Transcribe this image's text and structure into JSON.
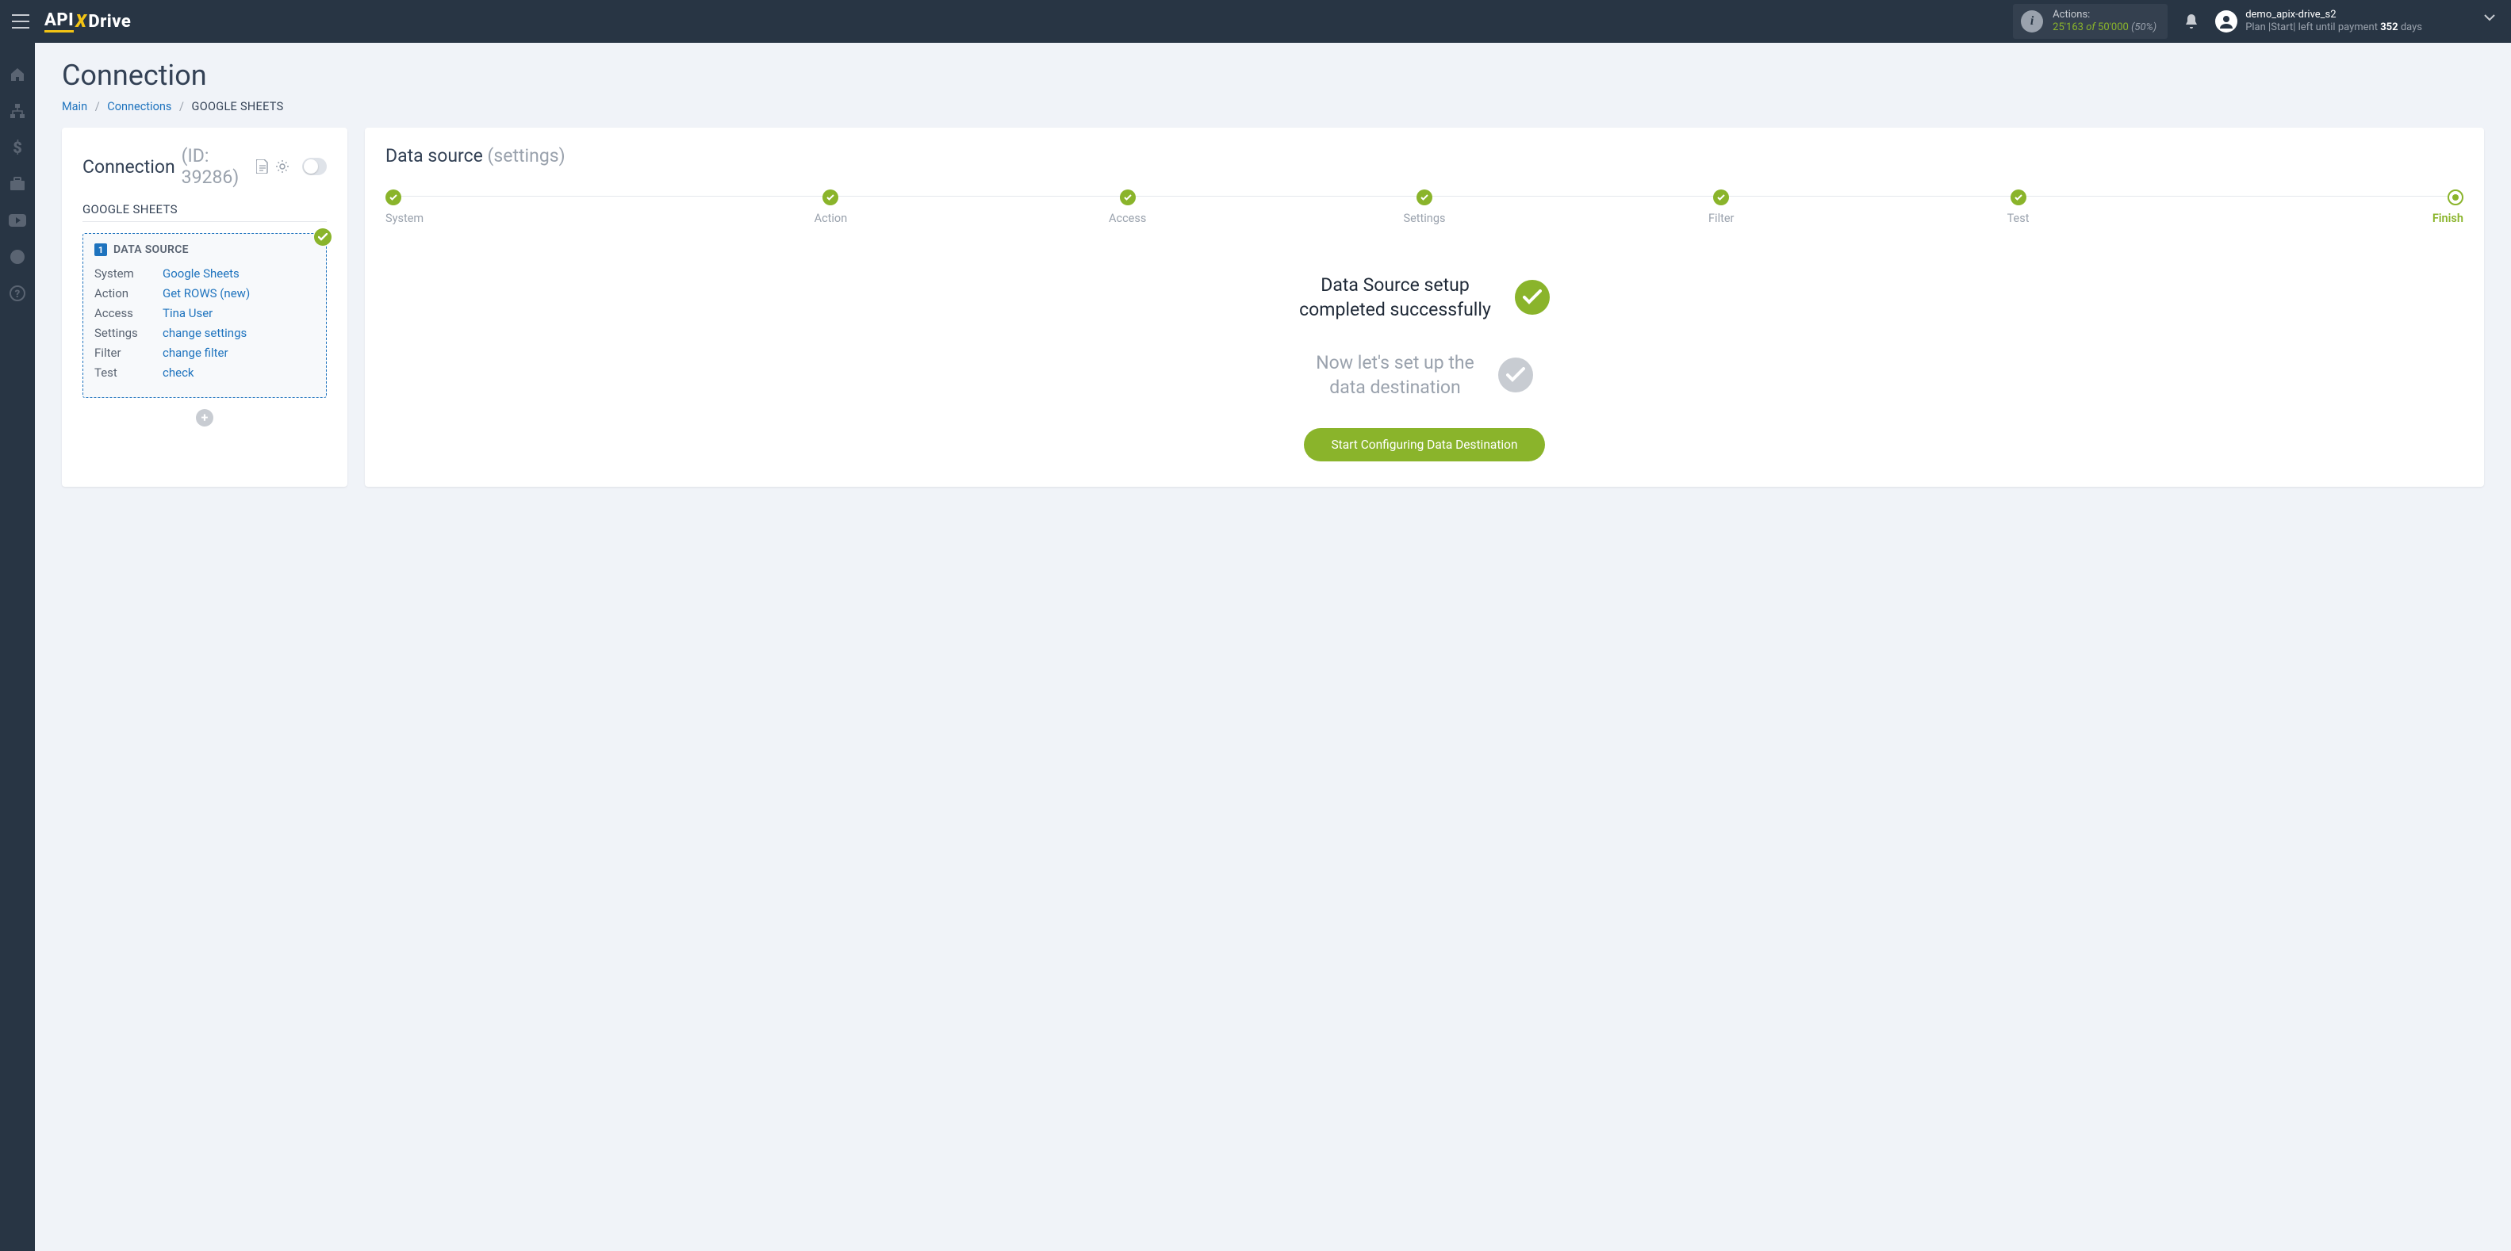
{
  "header": {
    "logo_left": "API",
    "logo_right": "Drive",
    "actions": {
      "label": "Actions:",
      "used": "25'163",
      "of": "of",
      "total": "50'000",
      "pct": "(50%)"
    },
    "user": {
      "name": "demo_apix-drive_s2",
      "plan_prefix": "Plan |Start| left until payment",
      "days_num": "352",
      "days_word": "days"
    }
  },
  "page": {
    "title": "Connection",
    "breadcrumb": {
      "main": "Main",
      "connections": "Connections",
      "current": "GOOGLE SHEETS"
    }
  },
  "left_card": {
    "heading": "Connection",
    "id_label": "(ID: 39286)",
    "subtitle": "GOOGLE SHEETS",
    "ds_title": "DATA SOURCE",
    "ds_num": "1",
    "rows": {
      "system": {
        "k": "System",
        "v": "Google Sheets"
      },
      "action": {
        "k": "Action",
        "v": "Get ROWS (new)"
      },
      "access": {
        "k": "Access",
        "v": "Tina User"
      },
      "settings": {
        "k": "Settings",
        "v": "change settings"
      },
      "filter": {
        "k": "Filter",
        "v": "change filter"
      },
      "test": {
        "k": "Test",
        "v": "check"
      }
    }
  },
  "right_card": {
    "title": "Data source",
    "subtitle": "(settings)",
    "steps": [
      "System",
      "Action",
      "Access",
      "Settings",
      "Filter",
      "Test",
      "Finish"
    ],
    "msg1_l1": "Data Source setup",
    "msg1_l2": "completed successfully",
    "msg2_l1": "Now let's set up the",
    "msg2_l2": "data destination",
    "button": "Start Configuring Data Destination"
  }
}
